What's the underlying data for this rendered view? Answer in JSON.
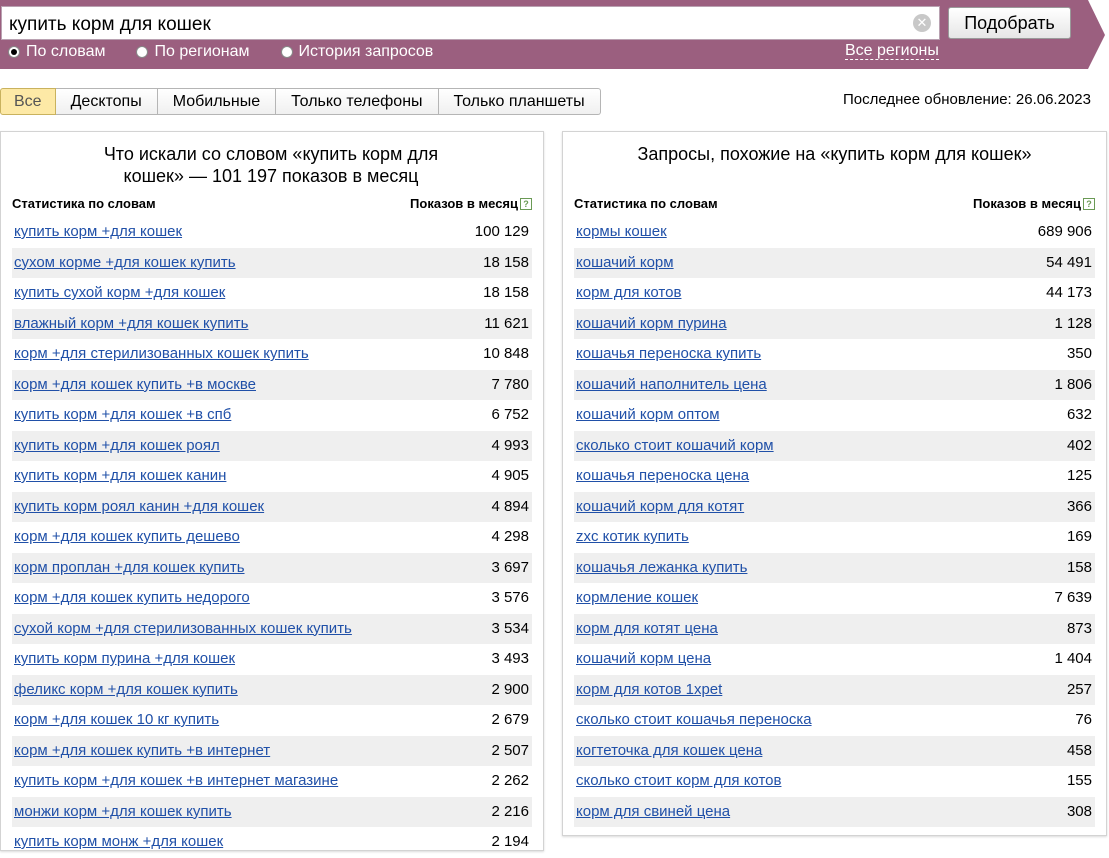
{
  "search": {
    "value": "купить корм для кошек",
    "clear_icon": "clear-icon",
    "button_label": "Подобрать"
  },
  "modes": [
    {
      "label": "По словам",
      "checked": true
    },
    {
      "label": "По регионам",
      "checked": false
    },
    {
      "label": "История запросов",
      "checked": false
    }
  ],
  "regions_link": "Все регионы",
  "tabs": [
    "Все",
    "Десктопы",
    "Мобильные",
    "Только телефоны",
    "Только планшеты"
  ],
  "last_update": "Последнее обновление: 26.06.2023",
  "colors": {
    "topbar": "#9b5f7f",
    "active_tab": "#fde9a6",
    "link": "#2050a8",
    "row_alt": "#efefef"
  },
  "left": {
    "title": "Что искали со словом «купить корм для кошек» — 101 197 показов в месяц",
    "col1": "Статистика по словам",
    "col2": "Показов в месяц",
    "rows": [
      {
        "q": "купить корм +для кошек",
        "n": "100 129"
      },
      {
        "q": "сухом корме +для кошек купить",
        "n": "18 158"
      },
      {
        "q": "купить сухой корм +для кошек",
        "n": "18 158"
      },
      {
        "q": "влажный корм +для кошек купить",
        "n": "11 621"
      },
      {
        "q": "корм +для стерилизованных кошек купить",
        "n": "10 848"
      },
      {
        "q": "корм +для кошек купить +в москве",
        "n": "7 780"
      },
      {
        "q": "купить корм +для кошек +в спб",
        "n": "6 752"
      },
      {
        "q": "купить корм +для кошек роял",
        "n": "4 993"
      },
      {
        "q": "купить корм +для кошек канин",
        "n": "4 905"
      },
      {
        "q": "купить корм роял канин +для кошек",
        "n": "4 894"
      },
      {
        "q": "корм +для кошек купить дешево",
        "n": "4 298"
      },
      {
        "q": "корм проплан +для кошек купить",
        "n": "3 697"
      },
      {
        "q": "корм +для кошек купить недорого",
        "n": "3 576"
      },
      {
        "q": "сухой корм +для стерилизованных кошек купить",
        "n": "3 534"
      },
      {
        "q": "купить корм пурина +для кошек",
        "n": "3 493"
      },
      {
        "q": "феликс корм +для кошек купить",
        "n": "2 900"
      },
      {
        "q": "корм +для кошек 10 кг купить",
        "n": "2 679"
      },
      {
        "q": "корм +для кошек купить +в интернет",
        "n": "2 507"
      },
      {
        "q": "купить корм +для кошек +в интернет магазине",
        "n": "2 262"
      },
      {
        "q": "монжи корм +для кошек купить",
        "n": "2 216"
      },
      {
        "q": "купить корм монж +для кошек",
        "n": "2 194"
      }
    ]
  },
  "right": {
    "title": "Запросы, похожие на «купить корм для кошек»",
    "col1": "Статистика по словам",
    "col2": "Показов в месяц",
    "rows": [
      {
        "q": "кормы кошек",
        "n": "689 906"
      },
      {
        "q": "кошачий корм",
        "n": "54 491"
      },
      {
        "q": "корм для котов",
        "n": "44 173"
      },
      {
        "q": "кошачий корм пурина",
        "n": "1 128"
      },
      {
        "q": "кошачья переноска купить",
        "n": "350"
      },
      {
        "q": "кошачий наполнитель цена",
        "n": "1 806"
      },
      {
        "q": "кошачий корм оптом",
        "n": "632"
      },
      {
        "q": "сколько стоит кошачий корм",
        "n": "402"
      },
      {
        "q": "кошачья переноска цена",
        "n": "125"
      },
      {
        "q": "кошачий корм для котят",
        "n": "366"
      },
      {
        "q": "zxc котик купить",
        "n": "169"
      },
      {
        "q": "кошачья лежанка купить",
        "n": "158"
      },
      {
        "q": "кормление кошек",
        "n": "7 639"
      },
      {
        "q": "корм для котят цена",
        "n": "873"
      },
      {
        "q": "кошачий корм цена",
        "n": "1 404"
      },
      {
        "q": "корм для котов 1xpet",
        "n": "257"
      },
      {
        "q": "сколько стоит кошачья переноска",
        "n": "76"
      },
      {
        "q": "когтеточка для кошек цена",
        "n": "458"
      },
      {
        "q": "сколько стоит корм для котов",
        "n": "155"
      },
      {
        "q": "корм для свиней цена",
        "n": "308"
      }
    ]
  }
}
